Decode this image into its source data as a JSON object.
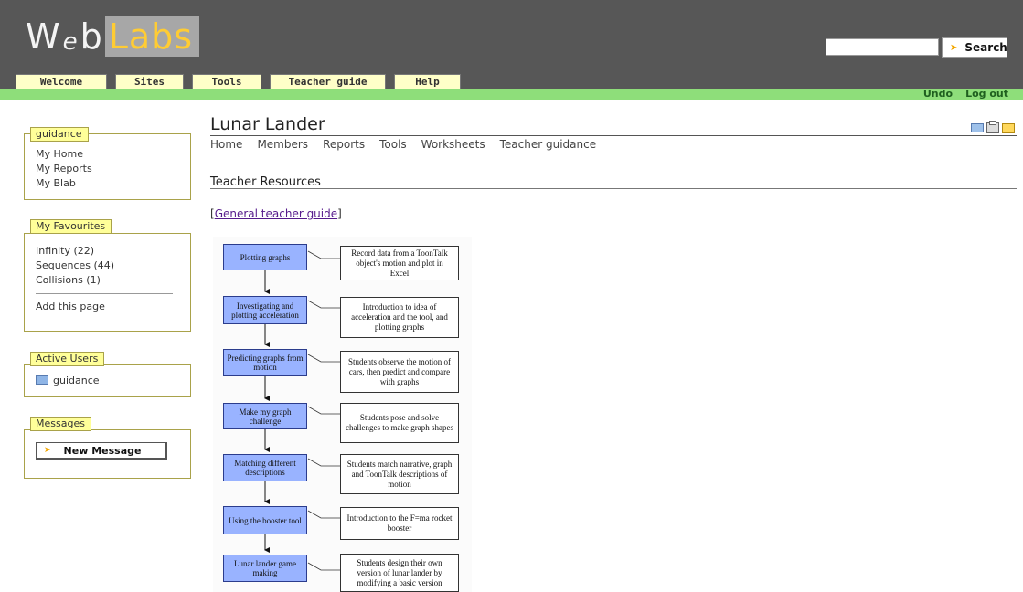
{
  "brand": {
    "logo_w": "W",
    "logo_e": "e",
    "logo_b": "b",
    "logo_labs": "Labs"
  },
  "search": {
    "placeholder": "",
    "button_label": "Search"
  },
  "topnav": [
    "Welcome",
    "Sites",
    "Tools",
    "Teacher guide",
    "Help"
  ],
  "utility": {
    "undo": "Undo",
    "logout": "Log out"
  },
  "sidebar": {
    "guidance": {
      "title": "guidance",
      "links": [
        "My Home",
        "My Reports",
        "My Blab"
      ]
    },
    "favourites": {
      "title": "My Favourites",
      "items": [
        "Infinity (22)",
        "Sequences (44)",
        "Collisions (1)"
      ],
      "add": "Add this page"
    },
    "active_users": {
      "title": "Active Users",
      "users": [
        "guidance"
      ]
    },
    "messages": {
      "title": "Messages",
      "new_message": "New Message"
    }
  },
  "page": {
    "title": "Lunar Lander",
    "subnav": [
      "Home",
      "Members",
      "Reports",
      "Tools",
      "Worksheets",
      "Teacher guidance"
    ],
    "section_title": "Teacher Resources",
    "guide_link": "General teacher guide",
    "bracket_open": "[",
    "bracket_close": "]"
  },
  "flowchart": {
    "steps": [
      {
        "box": "Plotting graphs",
        "note": "Record data from a ToonTalk object's motion and plot in Excel"
      },
      {
        "box": "Investigating and plotting acceleration",
        "note": "Introduction to idea of acceleration and the tool, and plotting graphs"
      },
      {
        "box": "Predicting graphs from motion",
        "note": "Students observe the motion of cars, then predict and compare with graphs"
      },
      {
        "box": "Make my graph challenge",
        "note": "Students pose and solve challenges to make graph shapes"
      },
      {
        "box": "Matching different descriptions",
        "note": "Students match narrative, graph and ToonTalk descriptions of motion"
      },
      {
        "box": "Using the booster tool",
        "note": "Introduction to the F=ma rocket booster"
      },
      {
        "box": "Lunar lander game making",
        "note": "Students design their own version of lunar lander by modifying a basic version"
      }
    ]
  },
  "colors": {
    "header": "#575757",
    "green_bar": "#8ede7a",
    "tab_bg": "#ffffc8",
    "box_title_bg": "#ffff99",
    "flow_box": "#99b3ff",
    "logo_labs": "#ffcc33"
  },
  "icons": [
    "search-arrow-icon",
    "mail-icon",
    "print-icon",
    "folder-icon",
    "new-message-arrow-icon"
  ]
}
